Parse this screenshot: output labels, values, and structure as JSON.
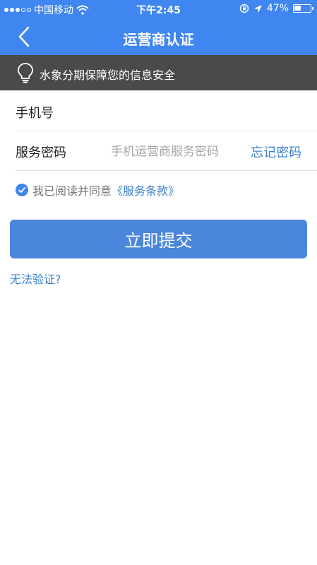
{
  "status_bar": {
    "carrier": "中国移动",
    "time": "下午2:45",
    "battery_percent_text": "47%",
    "battery_level": 0.47,
    "signal_bars_filled": 3,
    "signal_bars_total": 5,
    "icons": [
      "wifi-icon",
      "orientation-lock-icon",
      "location-arrow-icon",
      "battery-icon"
    ]
  },
  "nav": {
    "title": "运营商认证",
    "back_icon": "chevron-left-icon"
  },
  "notice": {
    "icon": "lightbulb-icon",
    "text": "水象分期保障您的信息安全"
  },
  "form": {
    "phone": {
      "label": "手机号",
      "value": "",
      "placeholder": ""
    },
    "password": {
      "label": "服务密码",
      "value": "",
      "placeholder": "手机运营商服务密码",
      "forgot_label": "忘记密码"
    }
  },
  "agreement": {
    "checked": true,
    "text": "我已阅读并同意",
    "link_text": "《服务条款》"
  },
  "actions": {
    "submit_label": "立即提交",
    "cannot_verify_label": "无法验证?"
  },
  "colors": {
    "header_bg": "#3f86f0",
    "notice_bg": "#4a4a4a",
    "button_bg": "#4a86db",
    "link": "#3a7fcb"
  }
}
